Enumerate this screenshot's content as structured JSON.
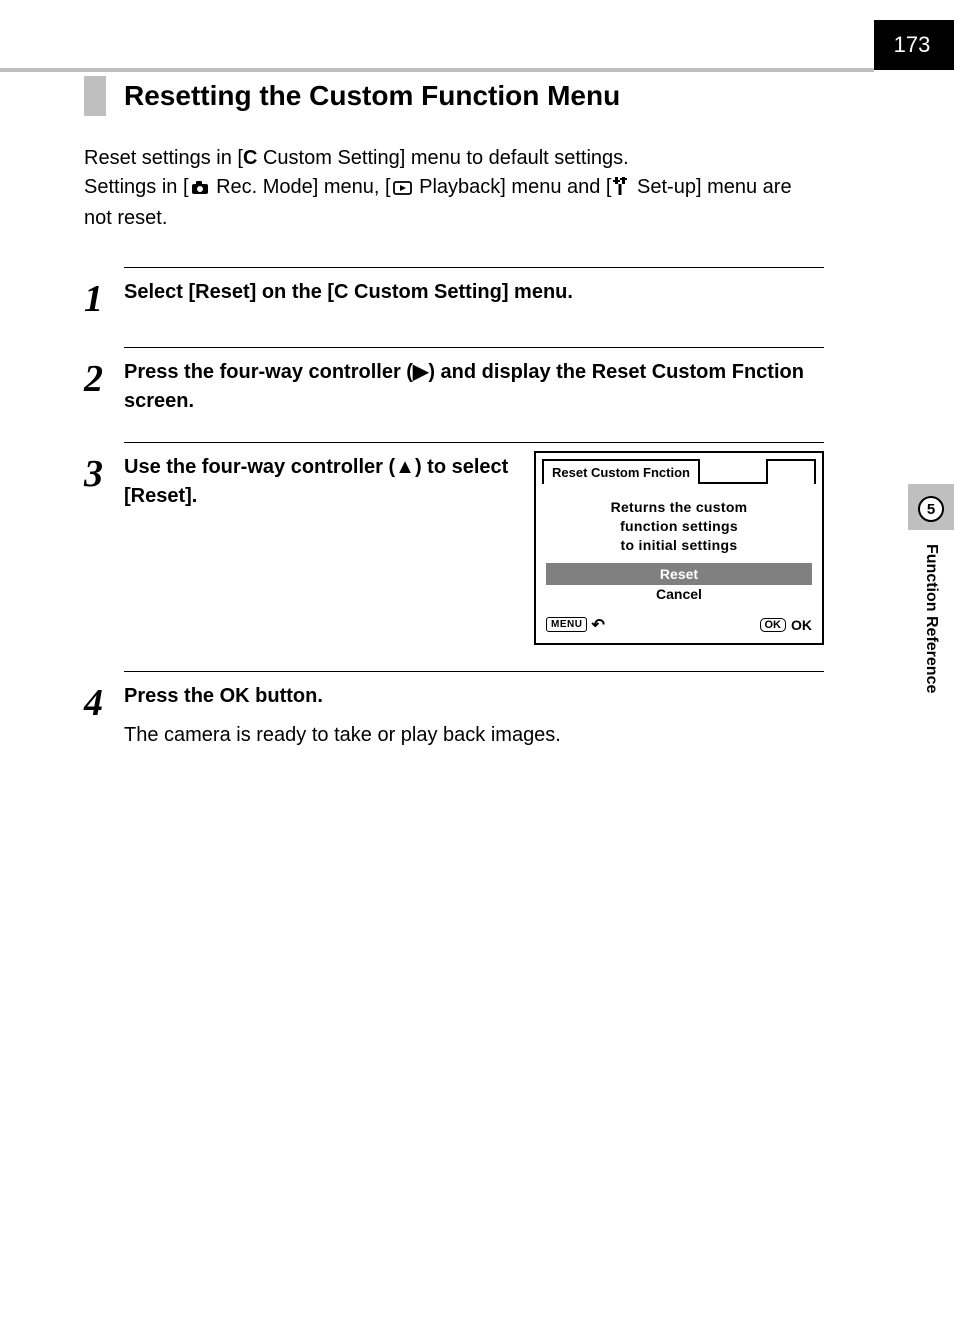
{
  "page_number": "173",
  "section_title": "Resetting the Custom Function Menu",
  "intro": {
    "line1_before": "Reset settings in [",
    "line1_c": "C",
    "line1_after": " Custom Setting] menu to default settings.",
    "line2_before": "Settings in [",
    "line2_rec": " Rec. Mode] menu, [",
    "line2_play": " Playback] menu and [",
    "line2_setup": " Set-up] menu are not reset."
  },
  "steps": {
    "s1": {
      "num": "1",
      "before": "Select [Reset] on the [",
      "c": "C",
      "after": " Custom Setting] menu."
    },
    "s2": {
      "num": "2",
      "text": "Press the four-way controller (▶) and display the Reset Custom Fnction screen."
    },
    "s3": {
      "num": "3",
      "text": "Use the four-way controller (▲) to select [Reset]."
    },
    "s4": {
      "num": "4",
      "before": "Press the ",
      "ok": "OK",
      "after": " button.",
      "body": "The camera is ready to take or play back images."
    }
  },
  "screen": {
    "tab": "Reset Custom Fnction",
    "msg1": "Returns the custom",
    "msg2": "function settings",
    "msg3": "to initial settings",
    "reset": "Reset",
    "cancel": "Cancel",
    "menu": "MENU",
    "ok_badge": "OK",
    "ok_text": "OK"
  },
  "side": {
    "num": "5",
    "label": "Function Reference"
  }
}
